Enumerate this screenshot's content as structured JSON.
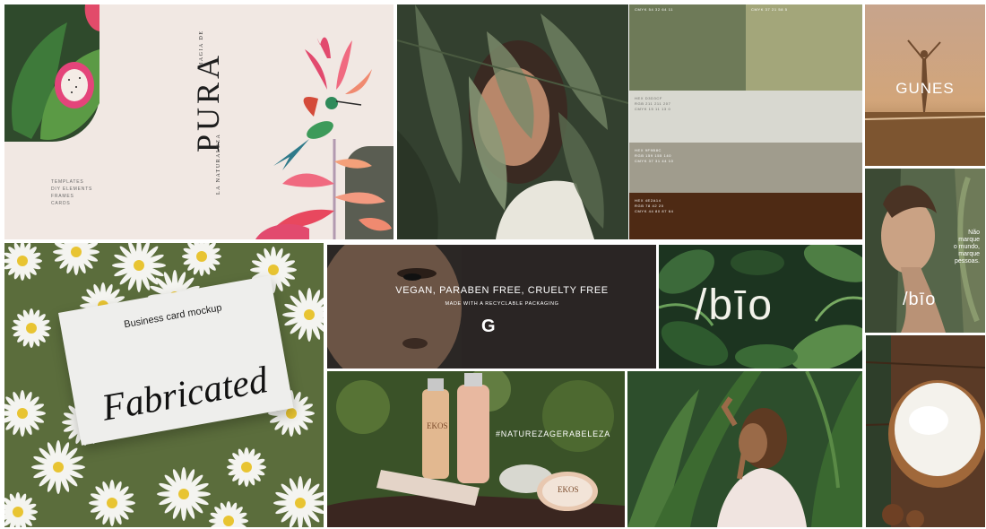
{
  "pura": {
    "vertical_top": "MAGIA DE",
    "title": "PURA",
    "vertical_bottom": "LA NATURALEZA",
    "list": [
      "TEMPLATES",
      "DIY ELEMENTS",
      "FRAMES",
      "CARDS"
    ]
  },
  "palette": {
    "top_left_label": "CMYK 54 32 64 11",
    "top_right_label": "CMYK 37 21 58 5",
    "swatches": [
      {
        "color": "#6e7a58"
      },
      {
        "color": "#a3a67a"
      },
      {
        "color": "#d8d8d0",
        "lines": [
          "HEX D3D3CF",
          "RGB 211 211 207",
          "CMYK 15 11 13 0"
        ]
      },
      {
        "color": "#a09c8d",
        "lines": [
          "HEX 9F9B8C",
          "RGB 159 155 140",
          "CMYK 37 31 44 10"
        ]
      },
      {
        "color": "#4e2a14",
        "lines": [
          "HEX 4E2A14",
          "RGB 78 42 20",
          "CMYK 44 80 87 64"
        ]
      }
    ]
  },
  "gunes": {
    "title": "GUNES"
  },
  "bio_portrait": {
    "quote": [
      "Não",
      "marque",
      "o mundo,",
      "marque",
      "pessoas."
    ],
    "logo": "/bīo"
  },
  "card": {
    "caption": "Business card mockup",
    "word": "Fabricated"
  },
  "vegan": {
    "headline": "VEGAN, PARABEN FREE, CRUELTY FREE",
    "subline": "MADE WITH A RECYCLABLE PACKAGING",
    "logo": "G"
  },
  "bio_leaves": {
    "logo": "/bīo"
  },
  "ekos": {
    "hashtag": "#NATUREZAGERABELEZA",
    "brand": "EKOS"
  },
  "colors": {
    "pura_bg": "#f1e8e3",
    "palette_green": "#6e7a58",
    "palette_brown": "#4e2a14",
    "vegan_bg": "#2a2624",
    "forest": "#1f3a22"
  }
}
